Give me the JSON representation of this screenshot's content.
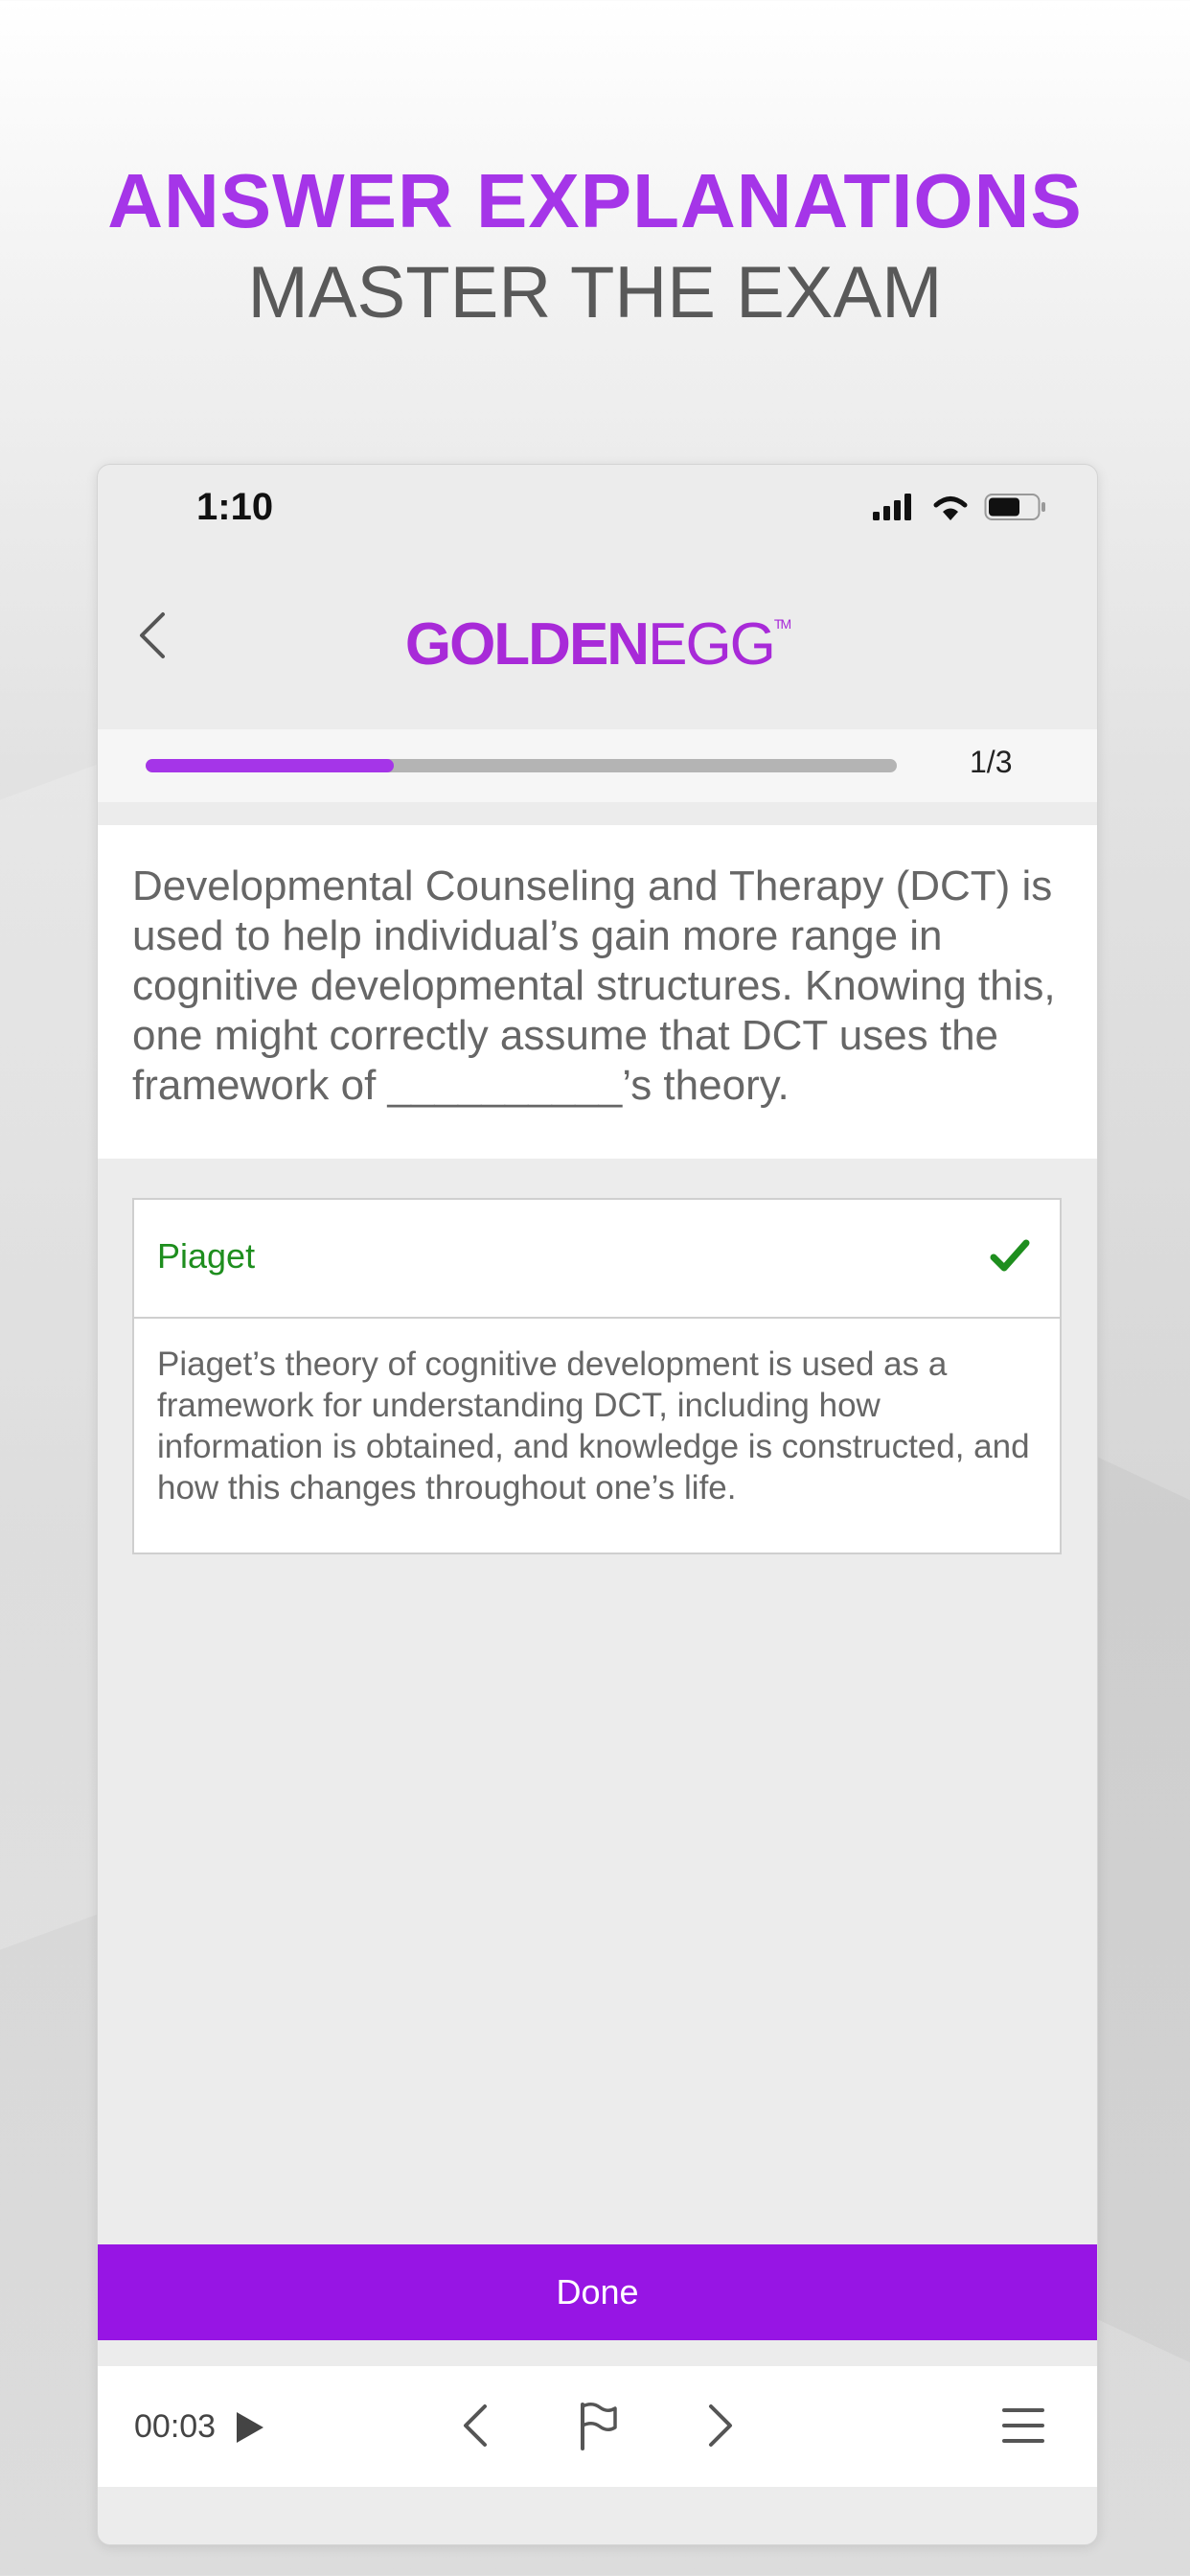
{
  "promo": {
    "headline": "ANSWER EXPLANATIONS",
    "subheadline": "MASTER THE EXAM"
  },
  "status_bar": {
    "time": "1:10",
    "icons": [
      "cellular-signal-icon",
      "wifi-icon",
      "battery-icon"
    ]
  },
  "nav": {
    "back_icon": "chevron-left-icon",
    "logo_bold": "GOLDEN",
    "logo_light": "EGG",
    "logo_mark": "TM"
  },
  "progress": {
    "fraction": 0.33,
    "label": "1/3"
  },
  "question": {
    "text": "Developmental Counseling and Therapy (DCT) is used to help individual’s gain more range in cognitive developmental structures. Knowing this, one might correctly assume that DCT uses the framework of __________’s theory."
  },
  "answer": {
    "label": "Piaget",
    "status": "correct",
    "status_icon": "checkmark-icon",
    "explanation": "Piaget’s theory of cognitive development is used as a framework for understanding DCT, including how information is obtained, and knowledge is constructed, and how this changes throughout one’s life."
  },
  "done_button": {
    "label": "Done"
  },
  "toolbar": {
    "timer": "00:03",
    "icons": [
      "play-icon",
      "previous-icon",
      "flag-icon",
      "next-icon",
      "menu-icon"
    ]
  },
  "colors": {
    "accent": "#a535e8",
    "button": "#9715e4",
    "correct": "#1e8e1e",
    "text": "#666666"
  }
}
